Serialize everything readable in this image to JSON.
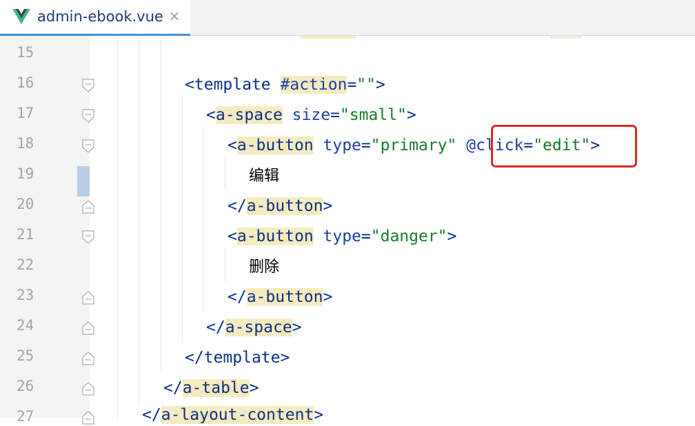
{
  "tab": {
    "title": "admin-ebook.vue",
    "close_label": "×",
    "icon": "vue-logo-icon"
  },
  "gutter": {
    "line_numbers": [
      "15",
      "16",
      "17",
      "18",
      "19",
      "20",
      "21",
      "22",
      "23",
      "24",
      "25",
      "26",
      "27"
    ]
  },
  "code": {
    "l16": {
      "open": "<",
      "tag": "template",
      "space": " ",
      "attr": "#action",
      "eq": "=",
      "val": "\"\"",
      "close": ">"
    },
    "l17": {
      "open": "<",
      "tag": "a-space",
      "space": " ",
      "attr": "size",
      "eq": "=",
      "val": "\"small\"",
      "close": ">"
    },
    "l18": {
      "open": "<",
      "tag": "a-button",
      "space": " ",
      "attr": "type",
      "eq": "=",
      "val": "\"primary\"",
      "space2": " ",
      "attr2": "@click",
      "eq2": "=",
      "val2": "\"edit\"",
      "close": ">"
    },
    "l19": {
      "text": "编辑"
    },
    "l20": {
      "open": "</",
      "tag": "a-button",
      "close": ">"
    },
    "l21": {
      "open": "<",
      "tag": "a-button",
      "space": " ",
      "attr": "type",
      "eq": "=",
      "val": "\"danger\"",
      "close": ">"
    },
    "l22": {
      "text": "删除"
    },
    "l23": {
      "open": "</",
      "tag": "a-button",
      "close": ">"
    },
    "l24": {
      "open": "</",
      "tag": "a-space",
      "close": ">"
    },
    "l25": {
      "open": "</",
      "tag": "template",
      "close": ">"
    },
    "l26": {
      "open": "</",
      "tag": "a-table",
      "close": ">"
    },
    "l27": {
      "open": "</",
      "tag": "a-layout-content",
      "close": ">"
    }
  },
  "colors": {
    "tag": "#0a2f86",
    "attribute": "#1b3ea6",
    "string": "#147a2a",
    "tag_highlight": "#f5ebc0",
    "callout_border": "#e02525"
  }
}
